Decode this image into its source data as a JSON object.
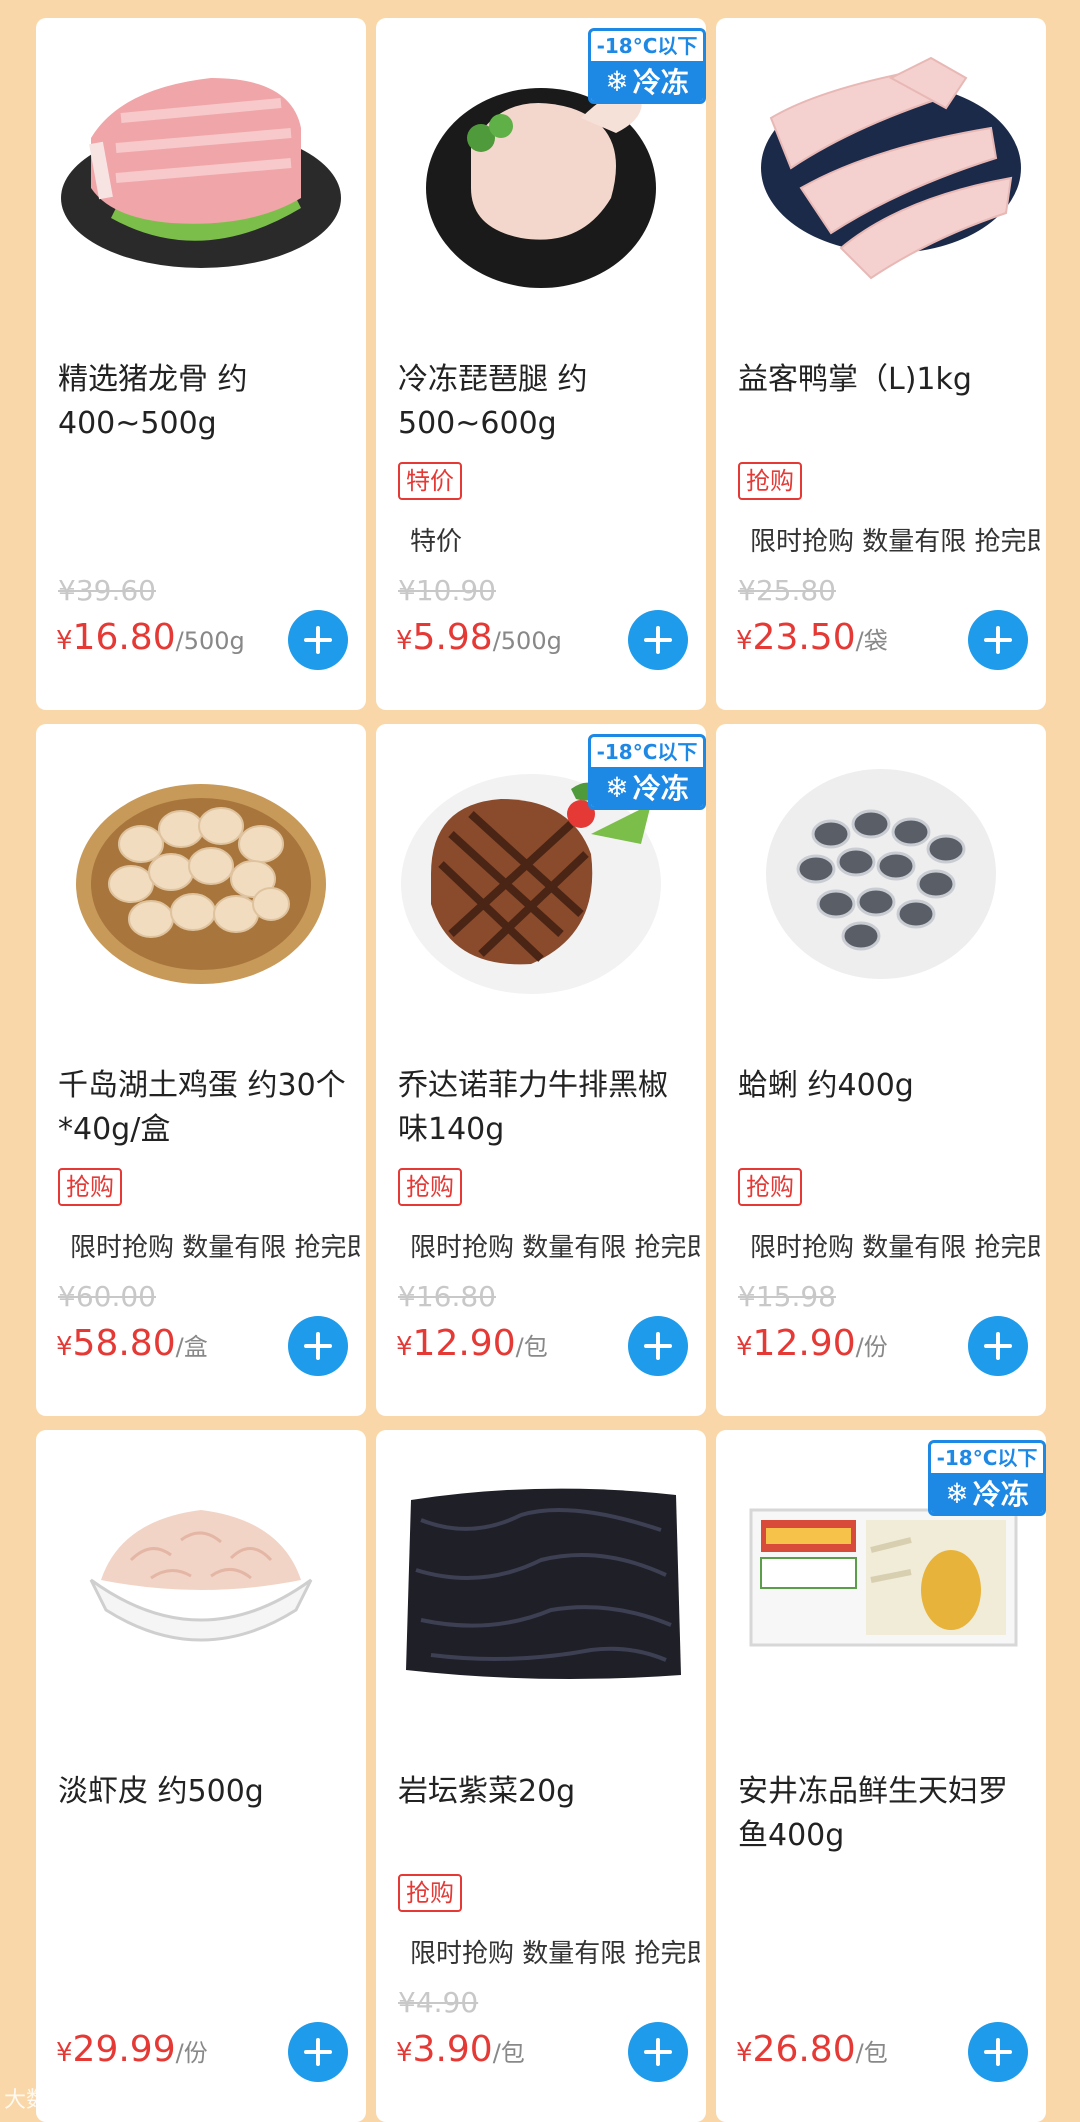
{
  "products": [
    {
      "title": "精选猪龙骨 约400~500g",
      "badge": "",
      "promo": "",
      "original_price": "¥39.60",
      "price": "16.80",
      "unit": "/500g",
      "freeze": false,
      "icon": "pork-ribs-image"
    },
    {
      "title": "冷冻琵琶腿 约500~600g",
      "badge": "特价",
      "promo": "特价",
      "original_price": "¥10.90",
      "price": "5.98",
      "unit": "/500g",
      "freeze": true,
      "icon": "chicken-drumstick-image"
    },
    {
      "title": "益客鸭掌（L)1kg",
      "badge": "抢购",
      "promo": "限时抢购 数量有限 抢完即止",
      "original_price": "¥25.80",
      "price": "23.50",
      "unit": "/袋",
      "freeze": false,
      "icon": "duck-feet-image"
    },
    {
      "title": "千岛湖土鸡蛋 约30个*40g/盒",
      "badge": "抢购",
      "promo": "限时抢购 数量有限 抢完即止",
      "original_price": "¥60.00",
      "price": "58.80",
      "unit": "/盒",
      "freeze": false,
      "icon": "eggs-basket-image"
    },
    {
      "title": "乔达诺菲力牛排黑椒味140g",
      "badge": "抢购",
      "promo": "限时抢购 数量有限 抢完即止",
      "original_price": "¥16.80",
      "price": "12.90",
      "unit": "/包",
      "freeze": true,
      "icon": "beef-steak-image"
    },
    {
      "title": "蛤蜊 约400g",
      "badge": "抢购",
      "promo": "限时抢购 数量有限 抢完即止",
      "original_price": "¥15.98",
      "price": "12.90",
      "unit": "/份",
      "freeze": false,
      "icon": "clams-image"
    },
    {
      "title": "淡虾皮 约500g",
      "badge": "",
      "promo": "",
      "original_price": "",
      "price": "29.99",
      "unit": "/份",
      "freeze": false,
      "icon": "dried-shrimp-image"
    },
    {
      "title": "岩坛紫菜20g",
      "badge": "抢购",
      "promo": "限时抢购 数量有限 抢完即止",
      "original_price": "¥4.90",
      "price": "3.90",
      "unit": "/包",
      "freeze": false,
      "icon": "seaweed-image"
    },
    {
      "title": "安井冻品鲜生天妇罗鱼400g",
      "badge": "",
      "promo": "",
      "original_price": "",
      "price": "26.80",
      "unit": "/包",
      "freeze": true,
      "icon": "tempura-fish-package-image"
    }
  ],
  "freeze_tag": {
    "temp": "-18°C以下",
    "label": "冷冻"
  },
  "currency": "¥",
  "watermark": "大数跨境",
  "colors": {
    "background": "#f9d7a8",
    "price": "#e53935",
    "add_button": "#1e9bea",
    "freeze": "#1e88e5"
  }
}
